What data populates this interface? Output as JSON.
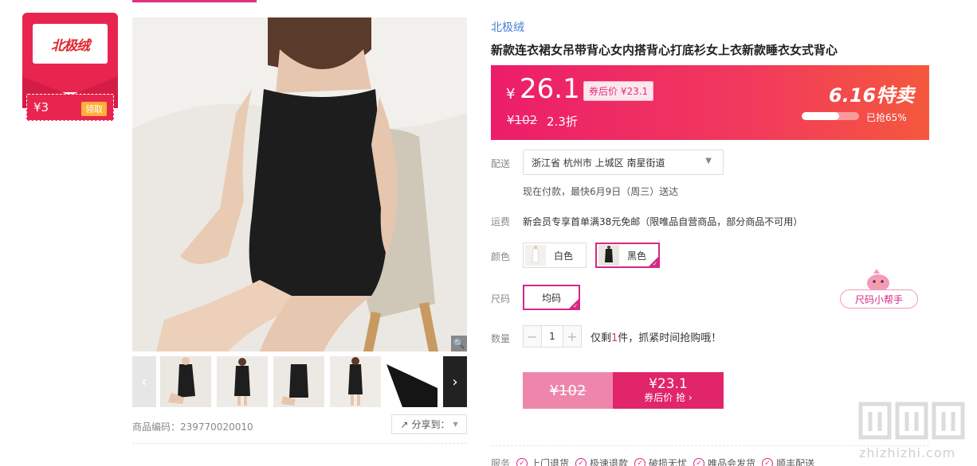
{
  "brand_card": {
    "logo_text": "北极绒",
    "coupon_amount": "¥3",
    "coupon_button": "领取"
  },
  "gallery": {
    "prev_glyph": "‹",
    "next_glyph": "›",
    "zoom_glyph": "🔍",
    "thumbnails": [
      "thumb-1",
      "thumb-2",
      "thumb-3",
      "thumb-4",
      "thumb-5"
    ],
    "sku_code": "商品编码：239770020010",
    "share_label": "分享到："
  },
  "product": {
    "brand": "北极绒",
    "title": "新款连衣裙女吊带背心女内搭背心打底衫女上衣新款睡衣女式背心"
  },
  "price": {
    "yen": "¥",
    "current": "26.1",
    "coupon_tag": "券后价 ¥23.1",
    "original": "¥102",
    "discount": "2.3折",
    "promo_title": "6.16特卖",
    "progress_fraction": 0.65,
    "progress_label": "已抢65%"
  },
  "delivery": {
    "label": "配送",
    "address": "浙江省 杭州市 上城区 南星街道",
    "note": "现在付款，最快6月9日（周三）送达"
  },
  "shipping": {
    "label": "运费",
    "text": "新会员专享首单满38元免邮（限唯品自营商品，部分商品不可用）"
  },
  "color": {
    "label": "颜色",
    "options": [
      {
        "label": "白色",
        "selected": false
      },
      {
        "label": "黑色",
        "selected": true
      }
    ]
  },
  "size": {
    "label": "尺码",
    "options": [
      {
        "label": "均码",
        "selected": true
      }
    ],
    "helper": "尺码小帮手"
  },
  "quantity": {
    "label": "数量",
    "minus": "−",
    "plus": "+",
    "value": "1",
    "stock_prefix": "仅剩",
    "stock_count": "1",
    "stock_suffix": "件，抓紧时间抢购哦！"
  },
  "buy": {
    "original": "¥102",
    "price": "¥23.1",
    "label": "券后价 抢 ›"
  },
  "services": {
    "label": "服务",
    "items": [
      "上门退货",
      "极速退款",
      "破损无忧",
      "唯品会发货",
      "顺丰配送"
    ]
  },
  "watermark": {
    "text": "zhizhizhi.com"
  },
  "colors": {
    "accent": "#e0317c",
    "banner_start": "#ec1d6a",
    "banner_end": "#f5583c",
    "brand_red": "#e8254f",
    "link_blue": "#4a7fd6"
  }
}
